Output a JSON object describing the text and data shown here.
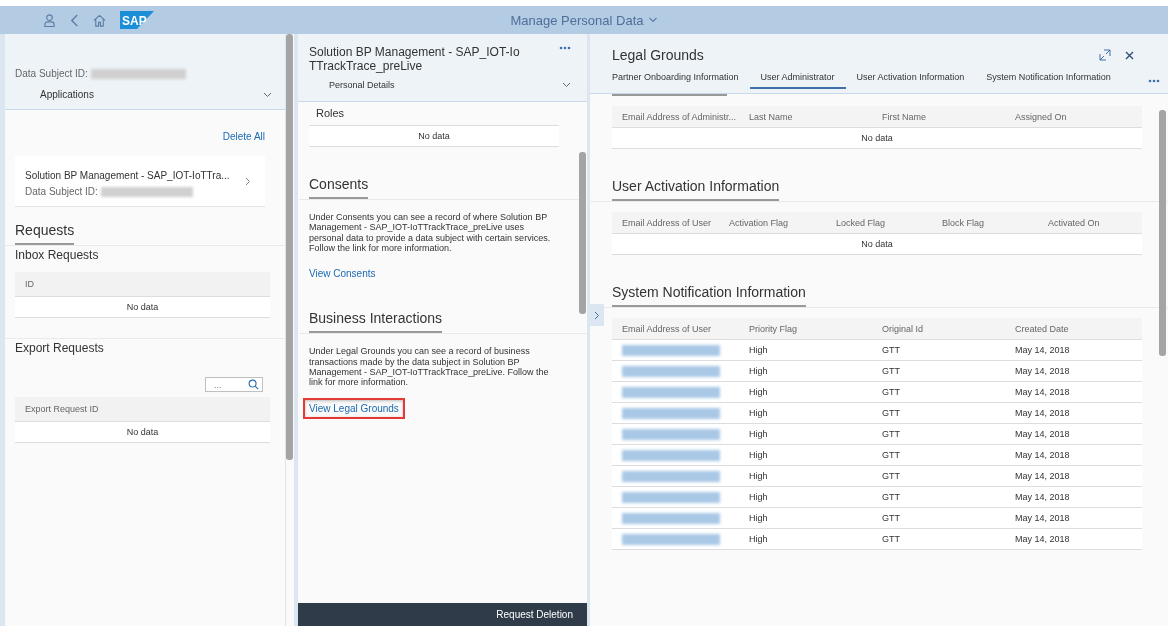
{
  "shell": {
    "logo": "SAP",
    "title": "Manage Personal Data"
  },
  "left": {
    "subject_label": "Data Subject ID:",
    "applications": "Applications",
    "delete_all": "Delete All",
    "application_card": {
      "title": "Solution BP Management - SAP_IOT-IoTTra...",
      "subject_label": "Data Subject ID:"
    },
    "requests_title": "Requests",
    "inbox": {
      "title": "Inbox Requests",
      "column": "ID",
      "empty": "No data"
    },
    "export": {
      "title": "Export Requests",
      "search_placeholder": "...",
      "column": "Export Request ID",
      "empty": "No data"
    }
  },
  "middle": {
    "title": "Solution BP Management - SAP_IOT-IoTTrackTrace_preLive",
    "section_select": "Personal Details",
    "roles": {
      "title": "Roles",
      "empty": "No data"
    },
    "sections": [
      {
        "title": "Consents",
        "text": "Under Consents you can see a record of where Solution BP Management - SAP_IOT-IoTTrackTrace_preLive uses personal data to provide a data subject with certain services. Follow the link for more information.",
        "link": "View Consents",
        "highlighted": false
      },
      {
        "title": "Business Interactions",
        "text": "Under Legal Grounds you can see a record of business transactions made by the data subject in Solution BP Management - SAP_IOT-IoTTrackTrace_preLive. Follow the link for more information.",
        "link": "View Legal Grounds",
        "highlighted": true
      }
    ],
    "footer_button": "Request Deletion"
  },
  "right": {
    "title": "Legal Grounds",
    "tabs": [
      {
        "label": "Partner Onboarding Information",
        "selected": false
      },
      {
        "label": "User Administrator",
        "selected": true
      },
      {
        "label": "User Activation Information",
        "selected": false
      },
      {
        "label": "System Notification Information",
        "selected": false
      }
    ],
    "admin_table": {
      "columns": [
        "Email Address of Administr...",
        "Last Name",
        "First Name",
        "Assigned On"
      ],
      "empty": "No data"
    },
    "activation": {
      "title": "User Activation Information",
      "columns": [
        "Email Address of User",
        "Activation Flag",
        "Locked Flag",
        "Block Flag",
        "Activated On"
      ],
      "empty": "No data"
    },
    "notification": {
      "title": "System Notification Information",
      "columns": [
        "Email Address of User",
        "Priority Flag",
        "Original Id",
        "Created Date"
      ],
      "rows": [
        {
          "priority": "High",
          "original_id": "GTT",
          "created_date": "May 14, 2018"
        },
        {
          "priority": "High",
          "original_id": "GTT",
          "created_date": "May 14, 2018"
        },
        {
          "priority": "High",
          "original_id": "GTT",
          "created_date": "May 14, 2018"
        },
        {
          "priority": "High",
          "original_id": "GTT",
          "created_date": "May 14, 2018"
        },
        {
          "priority": "High",
          "original_id": "GTT",
          "created_date": "May 14, 2018"
        },
        {
          "priority": "High",
          "original_id": "GTT",
          "created_date": "May 14, 2018"
        },
        {
          "priority": "High",
          "original_id": "GTT",
          "created_date": "May 14, 2018"
        },
        {
          "priority": "High",
          "original_id": "GTT",
          "created_date": "May 14, 2018"
        },
        {
          "priority": "High",
          "original_id": "GTT",
          "created_date": "May 14, 2018"
        },
        {
          "priority": "High",
          "original_id": "GTT",
          "created_date": "May 14, 2018"
        }
      ]
    }
  }
}
